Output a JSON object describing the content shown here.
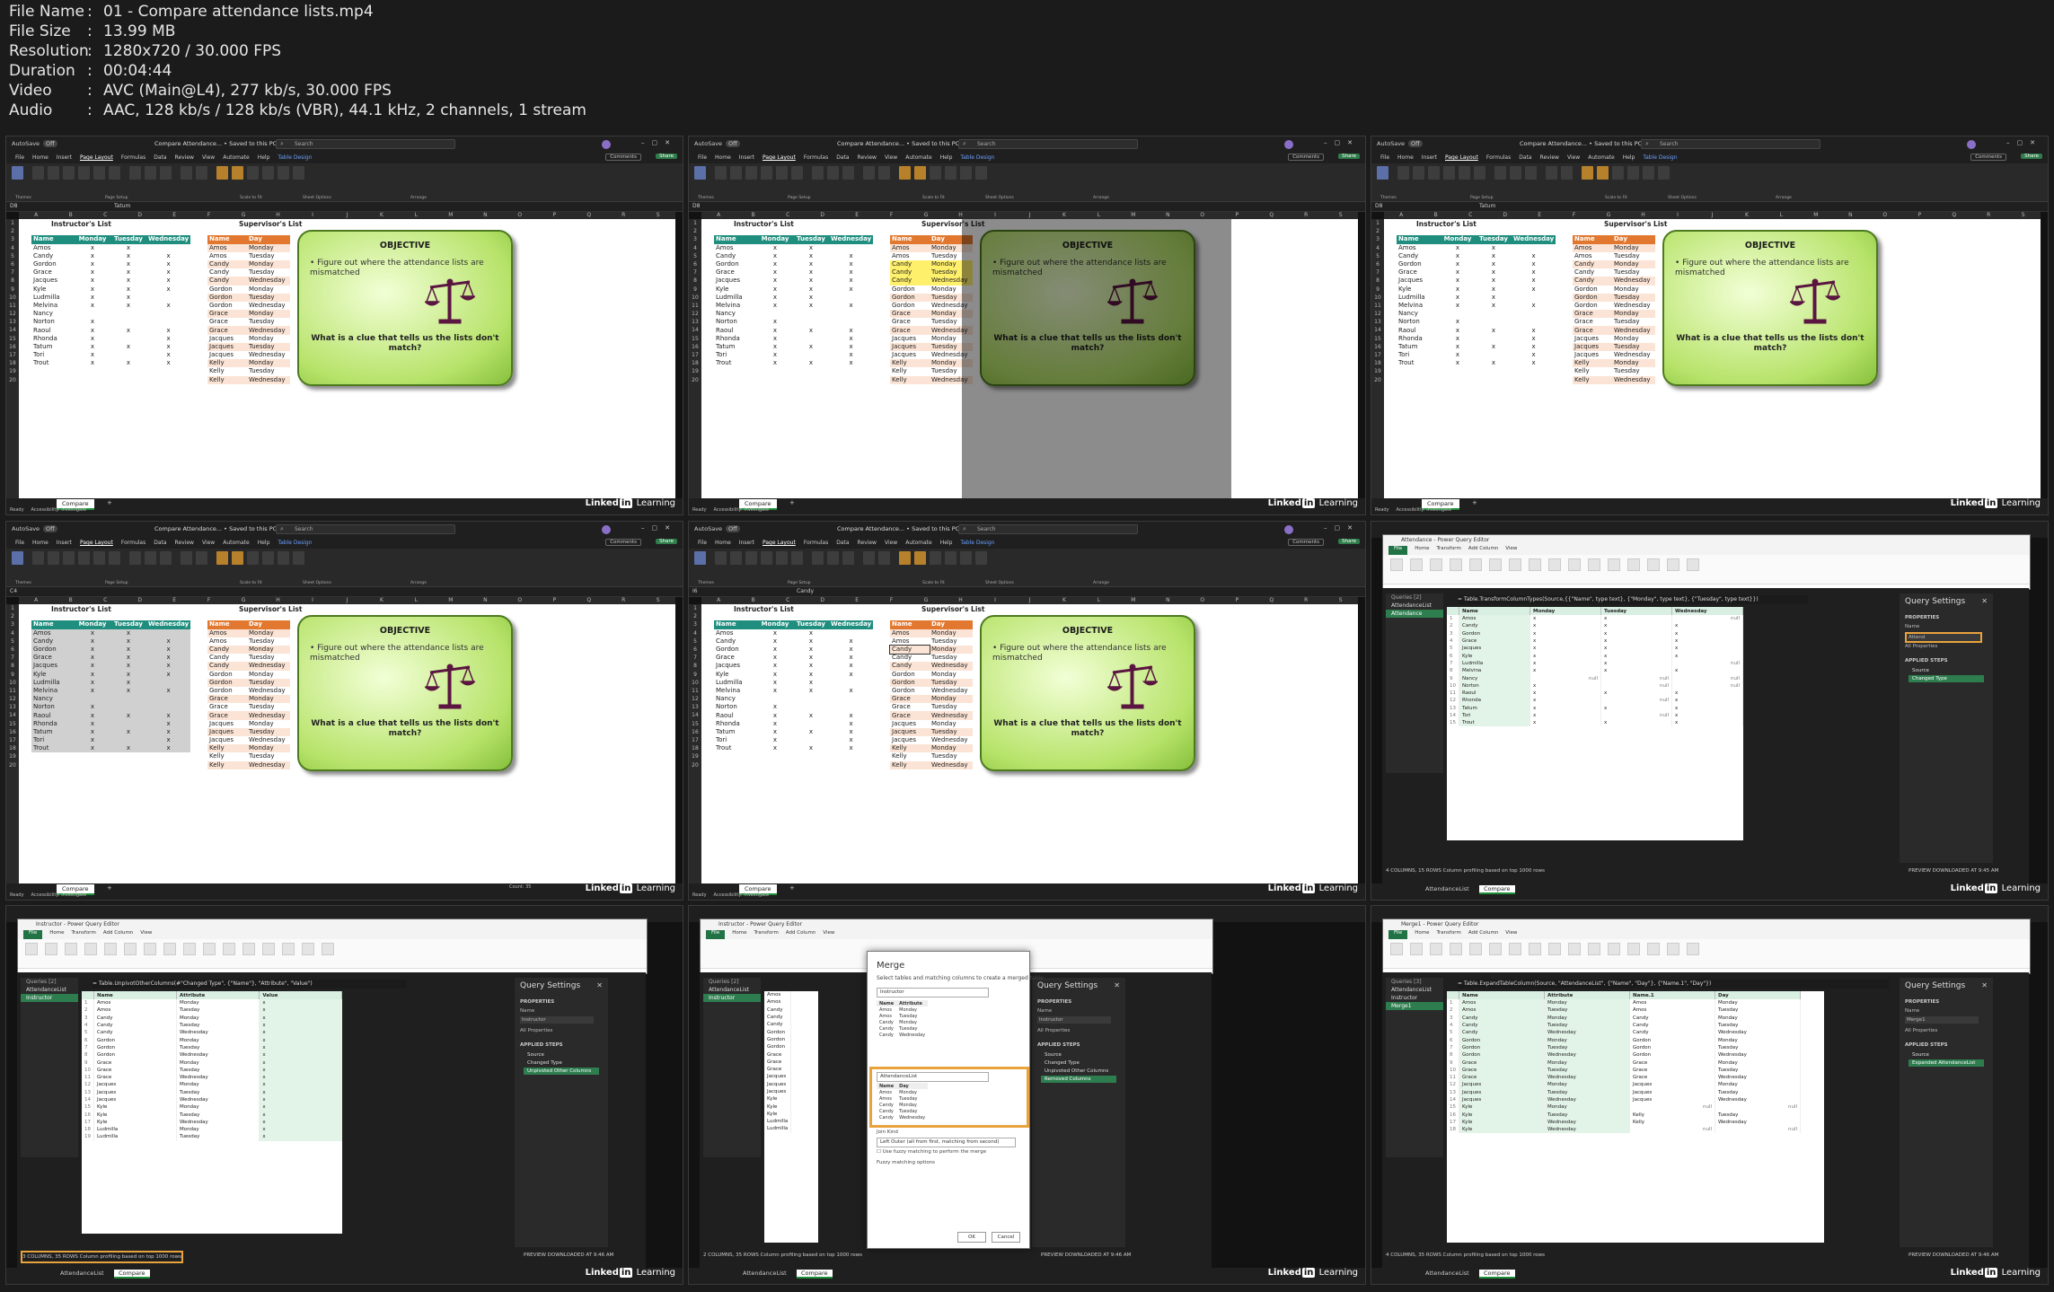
{
  "info": [
    {
      "key": "File Name",
      "value": "01 - Compare attendance lists.mp4"
    },
    {
      "key": "File Size",
      "value": "13.99 MB"
    },
    {
      "key": "Resolution",
      "value": "1280x720 / 30.000 FPS"
    },
    {
      "key": "Duration",
      "value": "00:04:44"
    },
    {
      "key": "Video",
      "value": "AVC (Main@L4), 277 kb/s, 30.000 FPS"
    },
    {
      "key": "Audio",
      "value": "AAC, 128 kb/s / 128 kb/s (VBR), 44.1 kHz, 2 channels, 1 stream"
    }
  ],
  "excel": {
    "autosave": "AutoSave",
    "autosave_state": "Off",
    "title": "Compare Attendance... • Saved to this PC",
    "search": "Search",
    "menu": [
      "File",
      "Home",
      "Insert",
      "Page Layout",
      "Formulas",
      "Data",
      "Review",
      "View",
      "Automate",
      "Help",
      "Table Design"
    ],
    "comments": "Comments",
    "share": "Share",
    "ribbon_labels": [
      "Themes",
      "Page Setup",
      "Scale to Fit",
      "Sheet Options",
      "Arrange"
    ],
    "instructor_title": "Instructor's List",
    "supervisor_title": "Supervisor's List",
    "instructor_headers": [
      "Name",
      "Monday",
      "Tuesday",
      "Wednesday"
    ],
    "instructor_rows": [
      [
        "Amos",
        "x",
        "x",
        ""
      ],
      [
        "Candy",
        "x",
        "x",
        "x"
      ],
      [
        "Gordon",
        "x",
        "x",
        "x"
      ],
      [
        "Grace",
        "x",
        "x",
        "x"
      ],
      [
        "Jacques",
        "x",
        "x",
        "x"
      ],
      [
        "Kyle",
        "x",
        "x",
        "x"
      ],
      [
        "Ludmilla",
        "x",
        "x",
        ""
      ],
      [
        "Melvina",
        "x",
        "x",
        "x"
      ],
      [
        "Nancy",
        "",
        "",
        ""
      ],
      [
        "Norton",
        "x",
        "",
        ""
      ],
      [
        "Raoul",
        "x",
        "x",
        "x"
      ],
      [
        "Rhonda",
        "x",
        "",
        "x"
      ],
      [
        "Tatum",
        "x",
        "x",
        "x"
      ],
      [
        "Tori",
        "x",
        "",
        "x"
      ],
      [
        "Trout",
        "x",
        "x",
        "x"
      ]
    ],
    "supervisor_headers": [
      "Name",
      "Day"
    ],
    "supervisor_rows": [
      [
        "Amos",
        "Monday"
      ],
      [
        "Amos",
        "Tuesday"
      ],
      [
        "Candy",
        "Monday"
      ],
      [
        "Candy",
        "Tuesday"
      ],
      [
        "Candy",
        "Wednesday"
      ],
      [
        "Gordon",
        "Monday"
      ],
      [
        "Gordon",
        "Tuesday"
      ],
      [
        "Gordon",
        "Wednesday"
      ],
      [
        "Grace",
        "Monday"
      ],
      [
        "Grace",
        "Tuesday"
      ],
      [
        "Grace",
        "Wednesday"
      ],
      [
        "Jacques",
        "Monday"
      ],
      [
        "Jacques",
        "Tuesday"
      ],
      [
        "Jacques",
        "Wednesday"
      ],
      [
        "Kelly",
        "Monday"
      ],
      [
        "Kelly",
        "Tuesday"
      ],
      [
        "Kelly",
        "Wednesday"
      ]
    ],
    "objective_title": "OBJECTIVE",
    "objective_text": "Figure out where the attendance lists are mismatched",
    "objective_question": "What is a clue that tells us the lists don't match?",
    "sheet_tab": "Compare",
    "status_ready": "Ready",
    "status_accessibility": "Accessibility: Investigate",
    "name_boxes": [
      "D8",
      "D8",
      "D8",
      "C4",
      "I6"
    ],
    "formula_values": [
      "Tatum",
      "",
      "Tatum",
      "",
      "Candy"
    ],
    "count": "Count: 35"
  },
  "brand": {
    "prefix": "Linked",
    "in": "in",
    "suffix": " Learning"
  },
  "pq": {
    "app_title_1": "Attendance - Power Query Editor",
    "app_title_2": "Instructor - Power Query Editor",
    "app_title_3": "Merge1 - Power Query Editor",
    "tabs": [
      "File",
      "Home",
      "Transform",
      "Add Column",
      "View"
    ],
    "query_settings": "Query Settings",
    "properties": "PROPERTIES",
    "name_label": "Name",
    "all_properties": "All Properties",
    "applied_steps": "APPLIED STEPS",
    "queries_label": "Queries [2]",
    "queries_label_3": "Queries [3]",
    "q1": {
      "queries": [
        "AttendanceList",
        "Attendance"
      ],
      "formula": "= Table.TransformColumnTypes(Source,{{\"Name\", type text}, {\"Monday\", type text}, {\"Tuesday\", type text}})",
      "headers": [
        "Name",
        "Monday",
        "Tuesday",
        "Wednesday"
      ],
      "rows": [
        [
          "Amos",
          "x",
          "x",
          "null"
        ],
        [
          "Candy",
          "x",
          "x",
          "x"
        ],
        [
          "Gordon",
          "x",
          "x",
          "x"
        ],
        [
          "Grace",
          "x",
          "x",
          "x"
        ],
        [
          "Jacques",
          "x",
          "x",
          "x"
        ],
        [
          "Kyle",
          "x",
          "x",
          "x"
        ],
        [
          "Ludmilla",
          "x",
          "x",
          "null"
        ],
        [
          "Melvina",
          "x",
          "x",
          "x"
        ],
        [
          "Nancy",
          "null",
          "null",
          "null"
        ],
        [
          "Norton",
          "x",
          "null",
          "null"
        ],
        [
          "Raoul",
          "x",
          "x",
          "x"
        ],
        [
          "Rhonda",
          "x",
          "null",
          "x"
        ],
        [
          "Tatum",
          "x",
          "x",
          "x"
        ],
        [
          "Tori",
          "x",
          "null",
          "x"
        ],
        [
          "Trout",
          "x",
          "x",
          "x"
        ]
      ],
      "name_value": "Attend",
      "steps": [
        "Source",
        "Changed Type"
      ],
      "status": "4 COLUMNS, 15 ROWS   Column profiling based on top 1000 rows",
      "preview": "PREVIEW DOWNLOADED AT 9:45 AM",
      "sheet_tabs": [
        "AttendanceList",
        "Compare"
      ]
    },
    "q2": {
      "queries": [
        "AttendanceList",
        "Instructor"
      ],
      "formula": "= Table.UnpivotOtherColumns(#\"Changed Type\", {\"Name\"}, \"Attribute\", \"Value\")",
      "headers": [
        "Name",
        "Attribute",
        "Value"
      ],
      "rows": [
        [
          "Amos",
          "Monday",
          "x"
        ],
        [
          "Amos",
          "Tuesday",
          "x"
        ],
        [
          "Candy",
          "Monday",
          "x"
        ],
        [
          "Candy",
          "Tuesday",
          "x"
        ],
        [
          "Candy",
          "Wednesday",
          "x"
        ],
        [
          "Gordon",
          "Monday",
          "x"
        ],
        [
          "Gordon",
          "Tuesday",
          "x"
        ],
        [
          "Gordon",
          "Wednesday",
          "x"
        ],
        [
          "Grace",
          "Monday",
          "x"
        ],
        [
          "Grace",
          "Tuesday",
          "x"
        ],
        [
          "Grace",
          "Wednesday",
          "x"
        ],
        [
          "Jacques",
          "Monday",
          "x"
        ],
        [
          "Jacques",
          "Tuesday",
          "x"
        ],
        [
          "Jacques",
          "Wednesday",
          "x"
        ],
        [
          "Kyle",
          "Monday",
          "x"
        ],
        [
          "Kyle",
          "Tuesday",
          "x"
        ],
        [
          "Kyle",
          "Wednesday",
          "x"
        ],
        [
          "Ludmilla",
          "Monday",
          "x"
        ],
        [
          "Ludmilla",
          "Tuesday",
          "x"
        ]
      ],
      "name_value": "Instructor",
      "steps": [
        "Source",
        "Changed Type",
        "Unpivoted Other Columns"
      ],
      "status": "3 COLUMNS, 35 ROWS   Column profiling based on top 1000 rows",
      "preview": "PREVIEW DOWNLOADED AT 9:46 AM",
      "sheet_tabs": [
        "AttendanceList",
        "Compare"
      ]
    },
    "merge": {
      "title": "Merge",
      "subtitle": "Select tables and matching columns to create a merged table.",
      "top_select": "Instructor",
      "top_headers": [
        "Name",
        "Attribute"
      ],
      "top_rows": [
        [
          "Amos",
          "Monday"
        ],
        [
          "Amos",
          "Tuesday"
        ],
        [
          "Candy",
          "Monday"
        ],
        [
          "Candy",
          "Tuesday"
        ],
        [
          "Candy",
          "Wednesday"
        ]
      ],
      "bottom_select": "AttendanceList",
      "bottom_headers": [
        "Name",
        "Day"
      ],
      "bottom_rows": [
        [
          "Amos",
          "Monday"
        ],
        [
          "Amos",
          "Tuesday"
        ],
        [
          "Candy",
          "Monday"
        ],
        [
          "Candy",
          "Tuesday"
        ],
        [
          "Candy",
          "Wednesday"
        ]
      ],
      "join_kind_label": "Join Kind",
      "join_kind": "Left Outer (all from first, matching from second)",
      "fuzzy": "Use fuzzy matching to perform the merge",
      "fuzzy_options": "Fuzzy matching options",
      "ok": "OK",
      "cancel": "Cancel",
      "steps": [
        "Source",
        "Changed Type",
        "Unpivoted Other Columns",
        "Removed Columns"
      ],
      "status": "2 COLUMNS, 35 ROWS   Column profiling based on top 1000 rows",
      "preview": "PREVIEW DOWNLOADED AT 9:46 AM"
    },
    "q3": {
      "queries": [
        "AttendanceList",
        "Instructor",
        "Merge1"
      ],
      "formula": "= Table.ExpandTableColumn(Source, \"AttendanceList\", {\"Name\", \"Day\"}, {\"Name.1\", \"Day\"})",
      "headers": [
        "Name",
        "Attribute",
        "Name.1",
        "Day"
      ],
      "rows": [
        [
          "Amos",
          "Monday",
          "Amos",
          "Monday"
        ],
        [
          "Amos",
          "Tuesday",
          "Amos",
          "Tuesday"
        ],
        [
          "Candy",
          "Monday",
          "Candy",
          "Monday"
        ],
        [
          "Candy",
          "Tuesday",
          "Candy",
          "Tuesday"
        ],
        [
          "Candy",
          "Wednesday",
          "Candy",
          "Wednesday"
        ],
        [
          "Gordon",
          "Monday",
          "Gordon",
          "Monday"
        ],
        [
          "Gordon",
          "Tuesday",
          "Gordon",
          "Tuesday"
        ],
        [
          "Gordon",
          "Wednesday",
          "Gordon",
          "Wednesday"
        ],
        [
          "Grace",
          "Monday",
          "Grace",
          "Monday"
        ],
        [
          "Grace",
          "Tuesday",
          "Grace",
          "Tuesday"
        ],
        [
          "Grace",
          "Wednesday",
          "Grace",
          "Wednesday"
        ],
        [
          "Jacques",
          "Monday",
          "Jacques",
          "Monday"
        ],
        [
          "Jacques",
          "Tuesday",
          "Jacques",
          "Tuesday"
        ],
        [
          "Jacques",
          "Wednesday",
          "Jacques",
          "Wednesday"
        ],
        [
          "Kyle",
          "Monday",
          "null",
          "null"
        ],
        [
          "Kyle",
          "Tuesday",
          "Kelly",
          "Tuesday"
        ],
        [
          "Kyle",
          "Wednesday",
          "Kelly",
          "Wednesday"
        ],
        [
          "Kyle",
          "Wednesday",
          "null",
          "null"
        ]
      ],
      "name_value": "Merge1",
      "steps": [
        "Source",
        "Expanded AttendanceList"
      ],
      "status": "4 COLUMNS, 35 ROWS   Column profiling based on top 1000 rows",
      "preview": "PREVIEW DOWNLOADED AT 9:46 AM",
      "sheet_tabs": [
        "AttendanceList",
        "Compare"
      ]
    }
  },
  "colors": {
    "teal_header": "#1f8e7e",
    "orange_header": "#e2782f",
    "peach_row": "#fbe4d5",
    "highlight_yellow": "#fff06b",
    "objective_green": "#b7e36a",
    "pq_green": "#2e7d4f",
    "orange_box": "#e8a33c"
  }
}
